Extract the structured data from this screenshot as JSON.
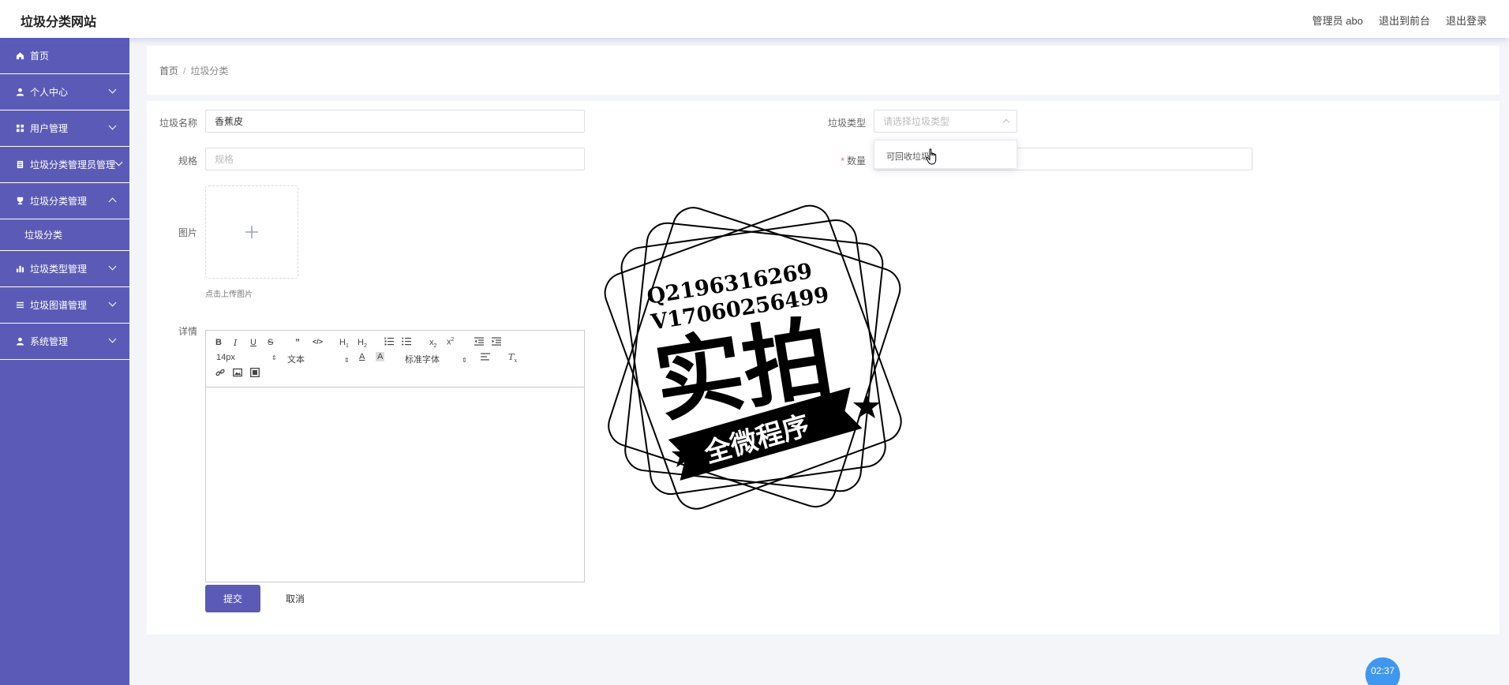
{
  "header": {
    "brand": "垃圾分类网站",
    "user_label": "管理员 abo",
    "to_front_label": "退出到前台",
    "logout_label": "退出登录"
  },
  "sidebar": {
    "items": [
      {
        "label": "首页",
        "icon": "home-icon"
      },
      {
        "label": "个人中心",
        "icon": "user-icon"
      },
      {
        "label": "用户管理",
        "icon": "grid-icon"
      },
      {
        "label": "垃圾分类管理员管理",
        "icon": "doc-icon"
      },
      {
        "label": "垃圾分类管理",
        "icon": "trophy-icon"
      },
      {
        "label": "垃圾类型管理",
        "icon": "bar-chart-icon"
      },
      {
        "label": "垃圾图谱管理",
        "icon": "list-icon"
      },
      {
        "label": "系统管理",
        "icon": "user-icon"
      }
    ],
    "sub_item": "垃圾分类",
    "accent": "#5b5bb7"
  },
  "breadcrumb": {
    "home": "首页",
    "separator": "/",
    "current": "垃圾分类"
  },
  "form": {
    "name_label": "垃圾名称",
    "name_value": "香蕉皮",
    "type_label": "垃圾类型",
    "type_placeholder": "请选择垃圾类型",
    "spec_label": "规格",
    "spec_placeholder": "规格",
    "qty_label": "数量",
    "image_label": "图片",
    "upload_tip": "点击上传图片",
    "detail_label": "详情",
    "submit_label": "提交",
    "cancel_label": "取消"
  },
  "editor": {
    "font_size": "14px",
    "paragraph": "文本",
    "font_family": "标准字体"
  },
  "dropdown": {
    "option": "可回收垃圾"
  },
  "watermark": {
    "line1": "Q2196316269",
    "line2": "V17060256499",
    "big_text": "实拍",
    "ribbon": "全微程序"
  },
  "timer": "02:37"
}
